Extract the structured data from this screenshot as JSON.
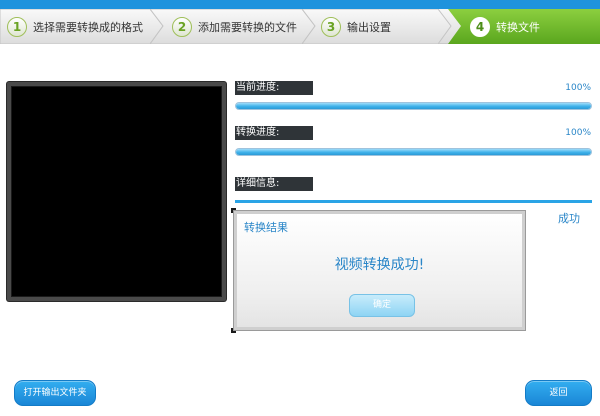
{
  "steps": [
    {
      "num": "1",
      "label": "选择需要转换成的格式"
    },
    {
      "num": "2",
      "label": "添加需要转换的文件"
    },
    {
      "num": "3",
      "label": "输出设置"
    },
    {
      "num": "4",
      "label": "转换文件"
    }
  ],
  "active_step": 4,
  "progress": {
    "current_label": "当前进度:",
    "current_value": "100%",
    "current_fraction": 1.0,
    "convert_label": "转换进度:",
    "convert_value": "100%",
    "convert_fraction": 1.0,
    "detail_label": "详细信息:",
    "status": "成功"
  },
  "dialog": {
    "title": "转换结果",
    "message": "视频转换成功!",
    "ok_label": "确定"
  },
  "buttons": {
    "open_folder": "打开输出文件夹",
    "back": "返回"
  },
  "colors": {
    "accent": "#1f93dd",
    "active_step": "#6fb52b",
    "text_blue": "#2a86c8"
  }
}
